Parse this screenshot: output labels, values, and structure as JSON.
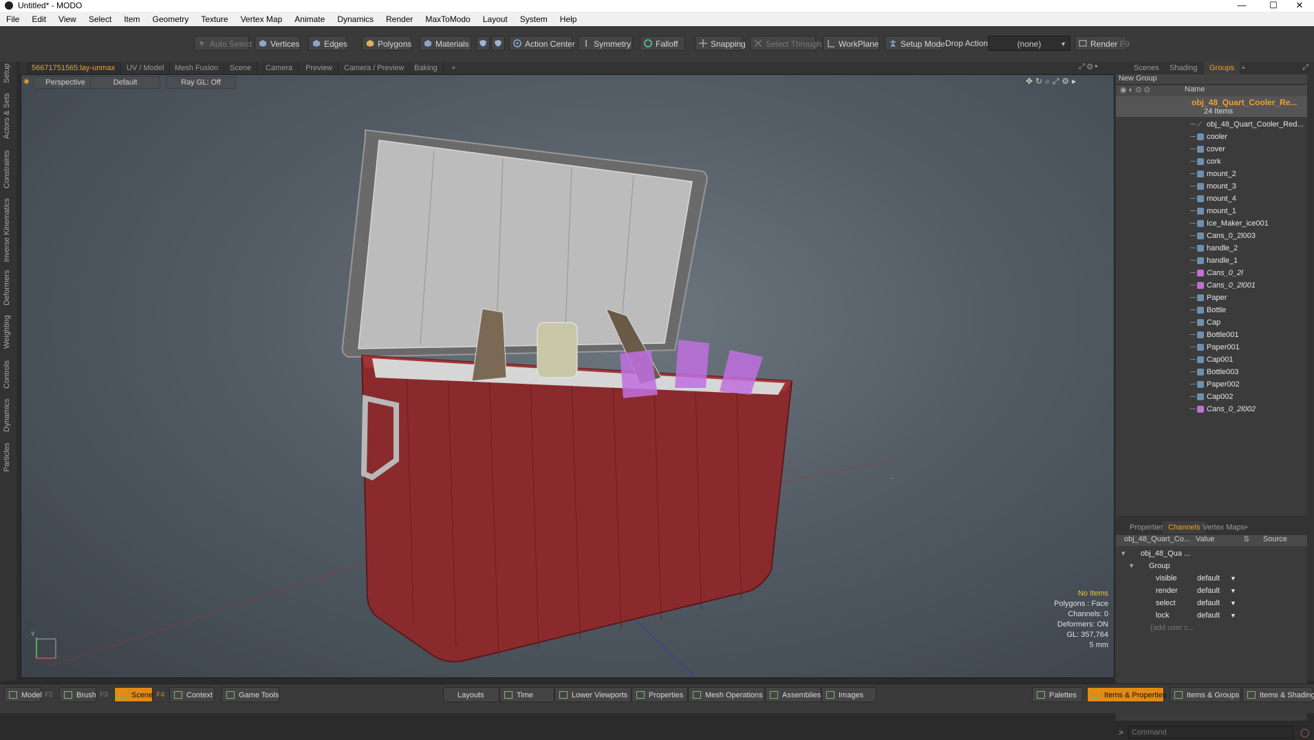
{
  "window": {
    "title": "Untitled* - MODO",
    "minimize": "—",
    "maximize": "☐",
    "close": "✕"
  },
  "menu": [
    "File",
    "Edit",
    "View",
    "Select",
    "Item",
    "Geometry",
    "Texture",
    "Vertex Map",
    "Animate",
    "Dynamics",
    "Render",
    "MaxToModo",
    "Layout",
    "System",
    "Help"
  ],
  "toolbar": {
    "auto_select": "Auto Select",
    "vertices": "Vertices",
    "edges": "Edges",
    "polygons": "Polygons",
    "materials": "Materials",
    "action_center": "Action Center",
    "symmetry": "Symmetry",
    "falloff": "Falloff",
    "snapping": "Snapping",
    "select_through": "Select Through",
    "workplane": "WorkPlane",
    "setup_mode": "Setup Mode",
    "drop_action": "Drop Action",
    "drop_action_value": "(none)",
    "render": "Render",
    "render_key": "F9"
  },
  "left_tabs": [
    "Setup",
    "Actors & Sets",
    "Constraints",
    "Inverse Kinematics",
    "Deformers",
    "Weighting",
    "Controls",
    "Dynamics",
    "Particles"
  ],
  "viewport_tabs": [
    "56671751565:lay-unmax",
    "UV / Model",
    "Mesh Fusion",
    "Scene",
    "Camera",
    "Preview",
    "Camera / Preview",
    "Baking",
    "+"
  ],
  "viewport": {
    "view": "Perspective",
    "shading": "Default",
    "raygl": "Ray GL: Off",
    "info": {
      "items": "No Items",
      "polygons": "Polygons : Face",
      "channels": "Channels: 0",
      "deformers": "Deformers: ON",
      "gl": "GL: 357,764",
      "scale": "5 mm"
    }
  },
  "right_tabs": [
    "Scenes",
    "Shading",
    "Groups",
    "+"
  ],
  "groups": {
    "new_group": "New Group",
    "name_header": "Name",
    "root": "obj_48_Quart_Cooler_Re...",
    "root_count": "24 Items",
    "items": [
      {
        "name": "obj_48_Quart_Cooler_Red...",
        "icon": "locator",
        "italic": false
      },
      {
        "name": "cooler",
        "icon": "mesh",
        "italic": false
      },
      {
        "name": "cover",
        "icon": "mesh",
        "italic": false
      },
      {
        "name": "cork",
        "icon": "mesh",
        "italic": false
      },
      {
        "name": "mount_2",
        "icon": "mesh",
        "italic": false
      },
      {
        "name": "mount_3",
        "icon": "mesh",
        "italic": false
      },
      {
        "name": "mount_4",
        "icon": "mesh",
        "italic": false
      },
      {
        "name": "mount_1",
        "icon": "mesh",
        "italic": false
      },
      {
        "name": "Ice_Maker_ice001",
        "icon": "mesh",
        "italic": false
      },
      {
        "name": "Cans_0_2l003",
        "icon": "mesh",
        "italic": false
      },
      {
        "name": "handle_2",
        "icon": "mesh",
        "italic": false
      },
      {
        "name": "handle_1",
        "icon": "mesh",
        "italic": false
      },
      {
        "name": "Cans_0_2l",
        "icon": "mesh-pink",
        "italic": true
      },
      {
        "name": "Cans_0_2l001",
        "icon": "mesh-pink",
        "italic": true
      },
      {
        "name": "Paper",
        "icon": "mesh",
        "italic": false
      },
      {
        "name": "Bottle",
        "icon": "mesh",
        "italic": false
      },
      {
        "name": "Cap",
        "icon": "mesh",
        "italic": false
      },
      {
        "name": "Bottle001",
        "icon": "mesh",
        "italic": false
      },
      {
        "name": "Paper001",
        "icon": "mesh",
        "italic": false
      },
      {
        "name": "Cap001",
        "icon": "mesh",
        "italic": false
      },
      {
        "name": "Bottle003",
        "icon": "mesh",
        "italic": false
      },
      {
        "name": "Paper002",
        "icon": "mesh",
        "italic": false
      },
      {
        "name": "Cap002",
        "icon": "mesh",
        "italic": false
      },
      {
        "name": "Cans_0_2l002",
        "icon": "mesh-pink",
        "italic": true
      }
    ]
  },
  "props_tabs": [
    "Properties",
    "Channels",
    "Vertex Maps",
    "+"
  ],
  "channels": {
    "headers": [
      "obj_48_Quart_Co...",
      "Value",
      "S",
      "Source"
    ],
    "root": "obj_48_Qua ...",
    "group": "Group",
    "rows": [
      {
        "name": "visible",
        "value": "default"
      },
      {
        "name": "render",
        "value": "default"
      },
      {
        "name": "select",
        "value": "default"
      },
      {
        "name": "lock",
        "value": "default"
      }
    ],
    "add_user": "(add user c..."
  },
  "command_placeholder": "Command",
  "bottom_left": [
    {
      "label": "Model",
      "key": "F2",
      "active": false
    },
    {
      "label": "Brush",
      "key": "F3",
      "active": false
    },
    {
      "label": "Scene",
      "key": "F4",
      "active": true
    },
    {
      "label": "Context",
      "key": "",
      "active": false
    },
    {
      "label": "Game Tools",
      "key": "",
      "active": false
    }
  ],
  "bottom_mid": [
    "Layouts",
    "Time",
    "Lower Viewports",
    "Properties",
    "Mesh Operations",
    "Assemblies",
    "Images"
  ],
  "bottom_right": [
    "Palettes",
    "Items & Properties",
    "Items & Groups",
    "Items & Shading"
  ],
  "colors": {
    "accent": "#f0a030",
    "cooler": "#8b2a2d",
    "pink_mesh": "#c070e0"
  }
}
